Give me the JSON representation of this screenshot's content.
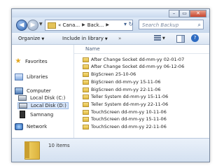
{
  "window": {
    "caption_buttons": [
      "–",
      "▭",
      "✕"
    ]
  },
  "nav": {
    "breadcrumbs": [
      "« Cana...",
      "Back..."
    ],
    "search_placeholder": "Search Backup"
  },
  "toolbar": {
    "organize": "Organize",
    "include": "Include in library"
  },
  "sidebar": {
    "favorites": "Favorites",
    "libraries": "Libraries",
    "computer": "Computer",
    "local_c": "Local Disk (C:)",
    "local_d": "Local Disk (D:)",
    "samnang": "Samnang",
    "network": "Network"
  },
  "content": {
    "column_name": "Name",
    "items": [
      "After Change Socket dd-mm-yy 02-01-07",
      "After Change Socket dd-mm-yy 06-12-06",
      "BigScreen 25-10-06",
      "BigScreen dd-mm-yy 15-11-06",
      "BigScreen dd-mm-yy 22-11-06",
      "Teller System dd-mm-yy 15-11-06",
      "Teller System dd-mm-yy 22-11-06",
      "TouchScreen dd-mm-yy 10-11-06",
      "TouchScreen dd-mm-yy 15-11-06",
      "TouchScreen dd-mm-yy 22-11-06"
    ]
  },
  "status": {
    "count": "10 items"
  },
  "icons": [
    "back-arrow-icon",
    "forward-arrow-icon",
    "folder-icon",
    "refresh-icon",
    "search-icon",
    "star-icon",
    "library-icon",
    "computer-icon",
    "disk-icon",
    "phone-icon",
    "network-icon",
    "views-icon",
    "preview-pane-icon",
    "help-icon"
  ]
}
